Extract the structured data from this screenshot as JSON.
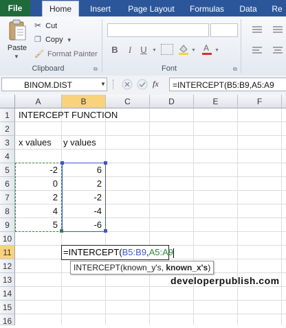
{
  "tabs": [
    "File",
    "Home",
    "Insert",
    "Page Layout",
    "Formulas",
    "Data",
    "Re"
  ],
  "active_tab": "Home",
  "clipboard": {
    "paste": "Paste",
    "cut": "Cut",
    "copy": "Copy",
    "format_painter": "Format Painter",
    "group_label": "Clipboard"
  },
  "font_group": {
    "bold": "B",
    "italic": "I",
    "underline": "U",
    "group_label": "Font"
  },
  "formula_bar": {
    "name_box": "BINOM.DIST",
    "fx": "fx",
    "formula": "=INTERCEPT(B5:B9,A5:A9"
  },
  "columns": [
    "A",
    "B",
    "C",
    "D",
    "E",
    "F"
  ],
  "rows": [
    "1",
    "2",
    "3",
    "4",
    "5",
    "6",
    "7",
    "8",
    "9",
    "10",
    "11",
    "12",
    "13",
    "14",
    "15",
    "16"
  ],
  "cells": {
    "title": "INTERCEPT FUNCTION",
    "x_header": "x values",
    "y_header": "y values",
    "x_values": [
      "-2",
      "0",
      "2",
      "4",
      "5"
    ],
    "y_values": [
      "6",
      "2",
      "-2",
      "-4",
      "-6"
    ]
  },
  "edit_cell": {
    "prefix": "=INTERCEPT(",
    "arg1": "B5:B9",
    "comma": ",",
    "arg2": "A5:A9"
  },
  "tooltip": {
    "fn": "INTERCEPT(",
    "arg1": "known_y's",
    "sep": ", ",
    "arg2": "known_x's",
    "close": ")"
  },
  "watermark": "developerpublish.com",
  "colors": {
    "tab_bar": "#2b579a",
    "file_tab": "#1f6a3a",
    "range1": "#3b58c4",
    "range2": "#2e8a3c",
    "active_header": "#f9d37c"
  }
}
